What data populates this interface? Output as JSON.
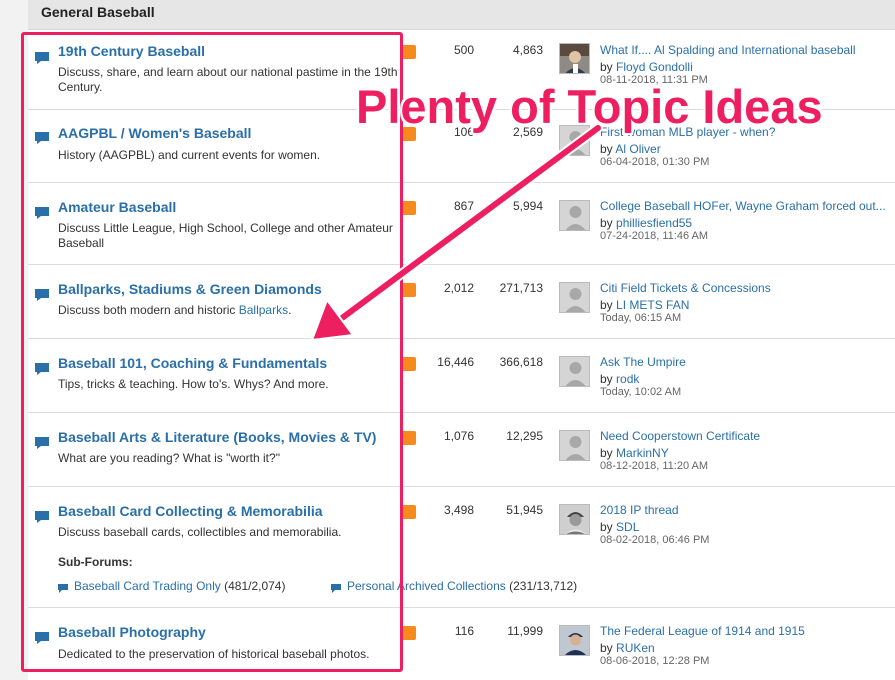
{
  "section": {
    "title": "General Baseball"
  },
  "forums": [
    {
      "title": "19th Century Baseball",
      "desc": "Discuss, share, and learn about our national pastime in the 19th Century.",
      "topics": "500",
      "posts": "4,863",
      "last_title": "What If.... Al Spalding and International baseball",
      "by": "by",
      "user": "Floyd Gondolli",
      "date": "08-11-2018, 11:31 PM",
      "avatar": "photo-avatar"
    },
    {
      "title": "AAGPBL / Women's Baseball",
      "desc": "History (AAGPBL) and current events for women.",
      "topics": "106",
      "posts": "2,569",
      "last_title": "First woman MLB player - when?",
      "by": "by",
      "user": "Al Oliver",
      "date": "06-04-2018, 01:30 PM",
      "avatar": "default-avatar"
    },
    {
      "title": "Amateur Baseball",
      "desc": "Discuss Little League, High School, College and other Amateur Baseball",
      "topics": "867",
      "posts": "5,994",
      "last_title": "College Baseball HOFer, Wayne Graham forced out...",
      "by": "by",
      "user": "philliesfiend55",
      "date": "07-24-2018, 11:46 AM",
      "avatar": "default-avatar"
    },
    {
      "title": "Ballparks, Stadiums & Green Diamonds",
      "desc_prefix": "Discuss both modern and historic ",
      "desc_link": "Ballparks",
      "desc_suffix": ".",
      "topics": "2,012",
      "posts": "271,713",
      "last_title": "Citi Field Tickets & Concessions",
      "by": "by",
      "user": "LI METS FAN",
      "date": "Today, 06:15 AM",
      "avatar": "default-avatar"
    },
    {
      "title": "Baseball 101, Coaching & Fundamentals",
      "desc": "Tips, tricks & teaching. How to's. Whys? And more.",
      "topics": "16,446",
      "posts": "366,618",
      "last_title": "Ask The Umpire",
      "by": "by",
      "user": "rodk",
      "date": "Today, 10:02 AM",
      "avatar": "default-avatar"
    },
    {
      "title": "Baseball Arts & Literature (Books, Movies & TV)",
      "desc": "What are you reading? What is \"worth it?\"",
      "topics": "1,076",
      "posts": "12,295",
      "last_title": "Need Cooperstown Certificate",
      "by": "by",
      "user": "MarkinNY",
      "date": "08-12-2018, 11:20 AM",
      "avatar": "default-avatar"
    },
    {
      "title": "Baseball Card Collecting & Memorabilia",
      "desc": "Discuss baseball cards, collectibles and memorabilia.",
      "topics": "3,498",
      "posts": "51,945",
      "last_title": "2018 IP thread",
      "by": "by",
      "user": "SDL",
      "date": "08-02-2018, 06:46 PM",
      "avatar": "photo-avatar",
      "subforums_label": "Sub-Forums:",
      "subforums": [
        {
          "name": "Baseball Card Trading Only",
          "count": "(481/2,074)"
        },
        {
          "name": "Personal Archived Collections",
          "count": "(231/13,712)"
        }
      ]
    },
    {
      "title": "Baseball Photography",
      "desc": "Dedicated to the preservation of historical baseball photos.",
      "topics": "116",
      "posts": "11,999",
      "last_title": "The Federal League of 1914 and 1915",
      "by": "by",
      "user": "RUKen",
      "date": "08-06-2018, 12:28 PM",
      "avatar": "photo-avatar"
    }
  ],
  "annotation": {
    "text": "Plenty of Topic Ideas",
    "color": "#ee1f60"
  },
  "colors": {
    "link": "#2a6fa8",
    "rss": "#f58a1f",
    "header_bg": "#e6e6e6"
  }
}
